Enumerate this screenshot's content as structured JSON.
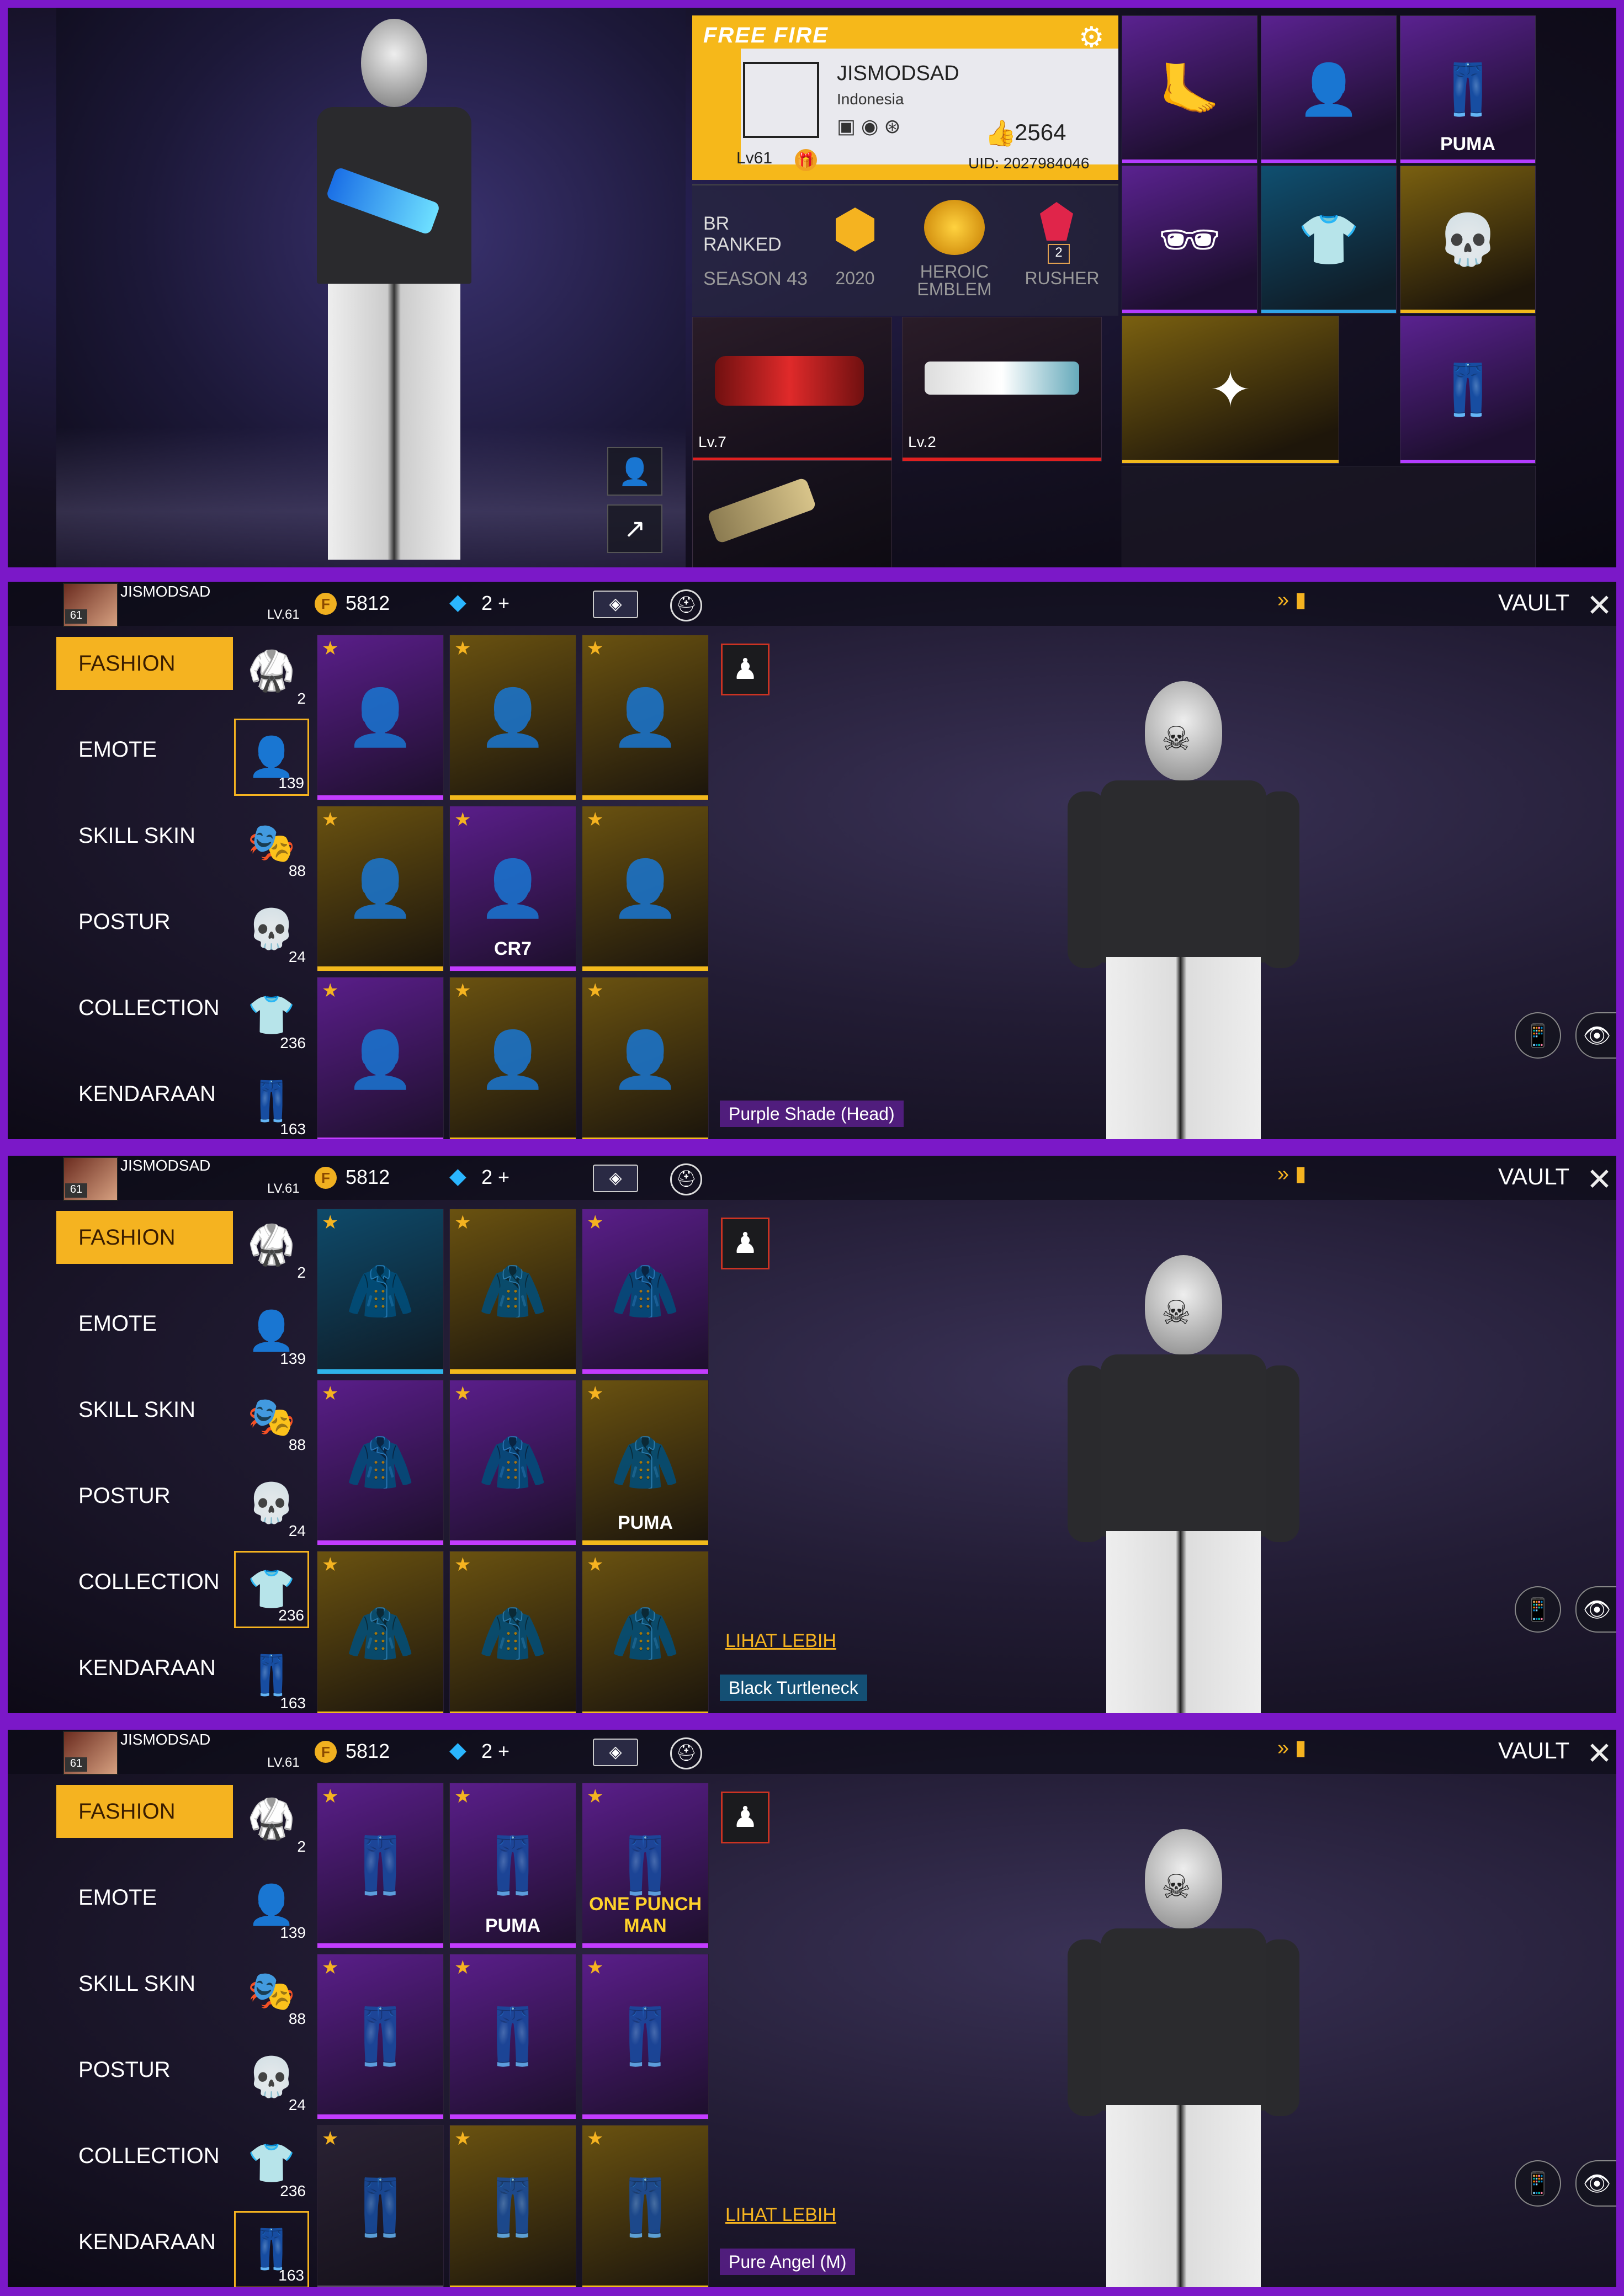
{
  "profile": {
    "game_logo": "FREE FIRE",
    "name": "JISMODSAD",
    "country": "Indonesia",
    "likes": "2564",
    "uid": "UID: 2027984046",
    "level": "Lv61",
    "rank_mode": "BR\nRANKED",
    "season": "SEASON 43",
    "rank_points": "2020",
    "emblem_label": "HEROIC\nEMBLEM",
    "rusher_count": "2",
    "rusher_label": "RUSHER",
    "weapon1_level": "Lv.7",
    "weapon2_level": "Lv.2",
    "equipped_icons": [
      "feet",
      "hair",
      "pants-puma",
      "mask-sunglasses",
      "shirt",
      "skull-mask",
      "gold-weapon",
      "pants"
    ],
    "puma_label": "PUMA"
  },
  "vault": {
    "player_name": "JISMODSAD",
    "player_level": "LV.61",
    "badge_level": "61",
    "coins": "5812",
    "diamonds": "2 +",
    "title": "VAULT",
    "menu": [
      "FASHION",
      "EMOTE",
      "SKILL SKIN",
      "POSTUR",
      "COLLECTION",
      "KENDARAAN"
    ],
    "categories": [
      {
        "icon": "outfit-icon",
        "count": "2"
      },
      {
        "icon": "hair-icon",
        "count": "139"
      },
      {
        "icon": "mask-icon",
        "count": "88"
      },
      {
        "icon": "face-paint-icon",
        "count": "24"
      },
      {
        "icon": "top-icon",
        "count": "236"
      },
      {
        "icon": "bottom-icon",
        "count": "163"
      }
    ]
  },
  "panel1": {
    "selected_category": 1,
    "items": [
      {
        "tier": "purple",
        "label": ""
      },
      {
        "tier": "gold",
        "label": ""
      },
      {
        "tier": "gold",
        "label": ""
      },
      {
        "tier": "gold",
        "label": ""
      },
      {
        "tier": "purple",
        "label": "CR7"
      },
      {
        "tier": "gold",
        "label": ""
      },
      {
        "tier": "purple",
        "label": ""
      },
      {
        "tier": "gold",
        "label": ""
      },
      {
        "tier": "gold",
        "label": ""
      }
    ],
    "equipped_name": "Purple Shade (Head)"
  },
  "panel2": {
    "selected_category": 4,
    "items": [
      {
        "tier": "blue",
        "label": ""
      },
      {
        "tier": "gold",
        "label": ""
      },
      {
        "tier": "purple",
        "label": ""
      },
      {
        "tier": "purple",
        "label": ""
      },
      {
        "tier": "purple",
        "label": ""
      },
      {
        "tier": "gold",
        "label": "PUMA"
      },
      {
        "tier": "gold",
        "label": ""
      },
      {
        "tier": "gold",
        "label": ""
      },
      {
        "tier": "gold",
        "label": ""
      }
    ],
    "see_more": "LIHAT LEBIH",
    "equipped_name": "Black Turtleneck"
  },
  "panel3": {
    "selected_category": 5,
    "items": [
      {
        "tier": "purple",
        "label": ""
      },
      {
        "tier": "purple",
        "label": "PUMA"
      },
      {
        "tier": "purple",
        "label": "ONE PUNCH MAN"
      },
      {
        "tier": "purple",
        "label": ""
      },
      {
        "tier": "purple",
        "label": ""
      },
      {
        "tier": "purple",
        "label": ""
      },
      {
        "tier": "plain",
        "label": ""
      },
      {
        "tier": "gold",
        "label": ""
      },
      {
        "tier": "gold",
        "label": ""
      }
    ],
    "see_more": "LIHAT LEBIH",
    "equipped_name": "Pure Angel (M)"
  },
  "colors": {
    "accent": "#f5b320",
    "frame": "#7b18c8",
    "purple_tier": "#c33cff",
    "gold_tier": "#f2b91c",
    "blue_tier": "#2fb4ea"
  }
}
